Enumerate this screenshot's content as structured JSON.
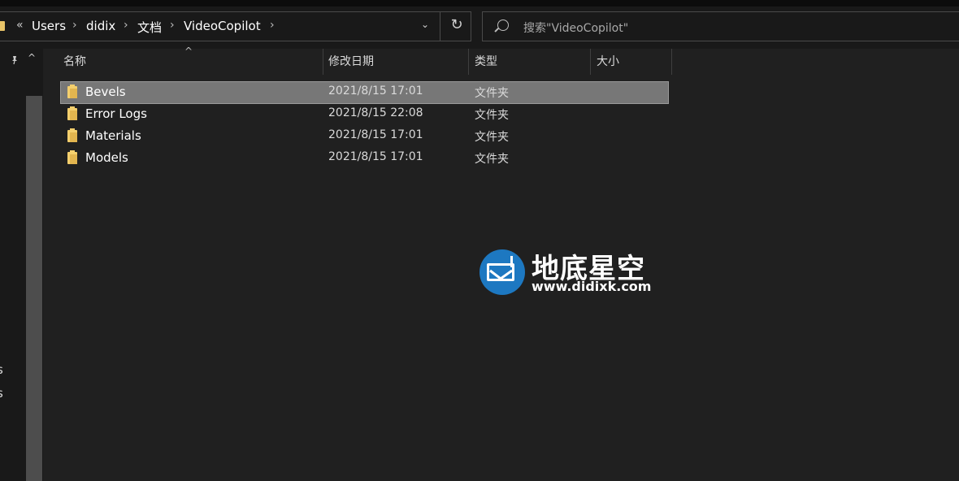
{
  "breadcrumb": {
    "overflow_glyph": "«",
    "items": [
      "Users",
      "didix",
      "文档",
      "VideoCopilot"
    ],
    "separator": "›"
  },
  "address": {
    "dropdown_glyph": "⌄",
    "refresh_glyph": "↻"
  },
  "search": {
    "placeholder": "搜索\"VideoCopilot\""
  },
  "nav": {
    "pin_glyph": "📌",
    "up_glyph": "^",
    "cut_labels": [
      "s",
      "s"
    ]
  },
  "columns": {
    "name": "名称",
    "date": "修改日期",
    "type": "类型",
    "size": "大小",
    "sort_glyph": "^"
  },
  "files": [
    {
      "name": "Bevels",
      "date": "2021/8/15 17:01",
      "type": "文件夹",
      "selected": true
    },
    {
      "name": "Error Logs",
      "date": "2021/8/15 22:08",
      "type": "文件夹",
      "selected": false
    },
    {
      "name": "Materials",
      "date": "2021/8/15 17:01",
      "type": "文件夹",
      "selected": false
    },
    {
      "name": "Models",
      "date": "2021/8/15 17:01",
      "type": "文件夹",
      "selected": false
    }
  ],
  "watermark": {
    "title": "地底星空",
    "url": "www.didixk.com"
  },
  "colors": {
    "background": "#202020",
    "selection": "#777777",
    "folder": "#f4cf6d",
    "logo": "#1d78c1"
  }
}
